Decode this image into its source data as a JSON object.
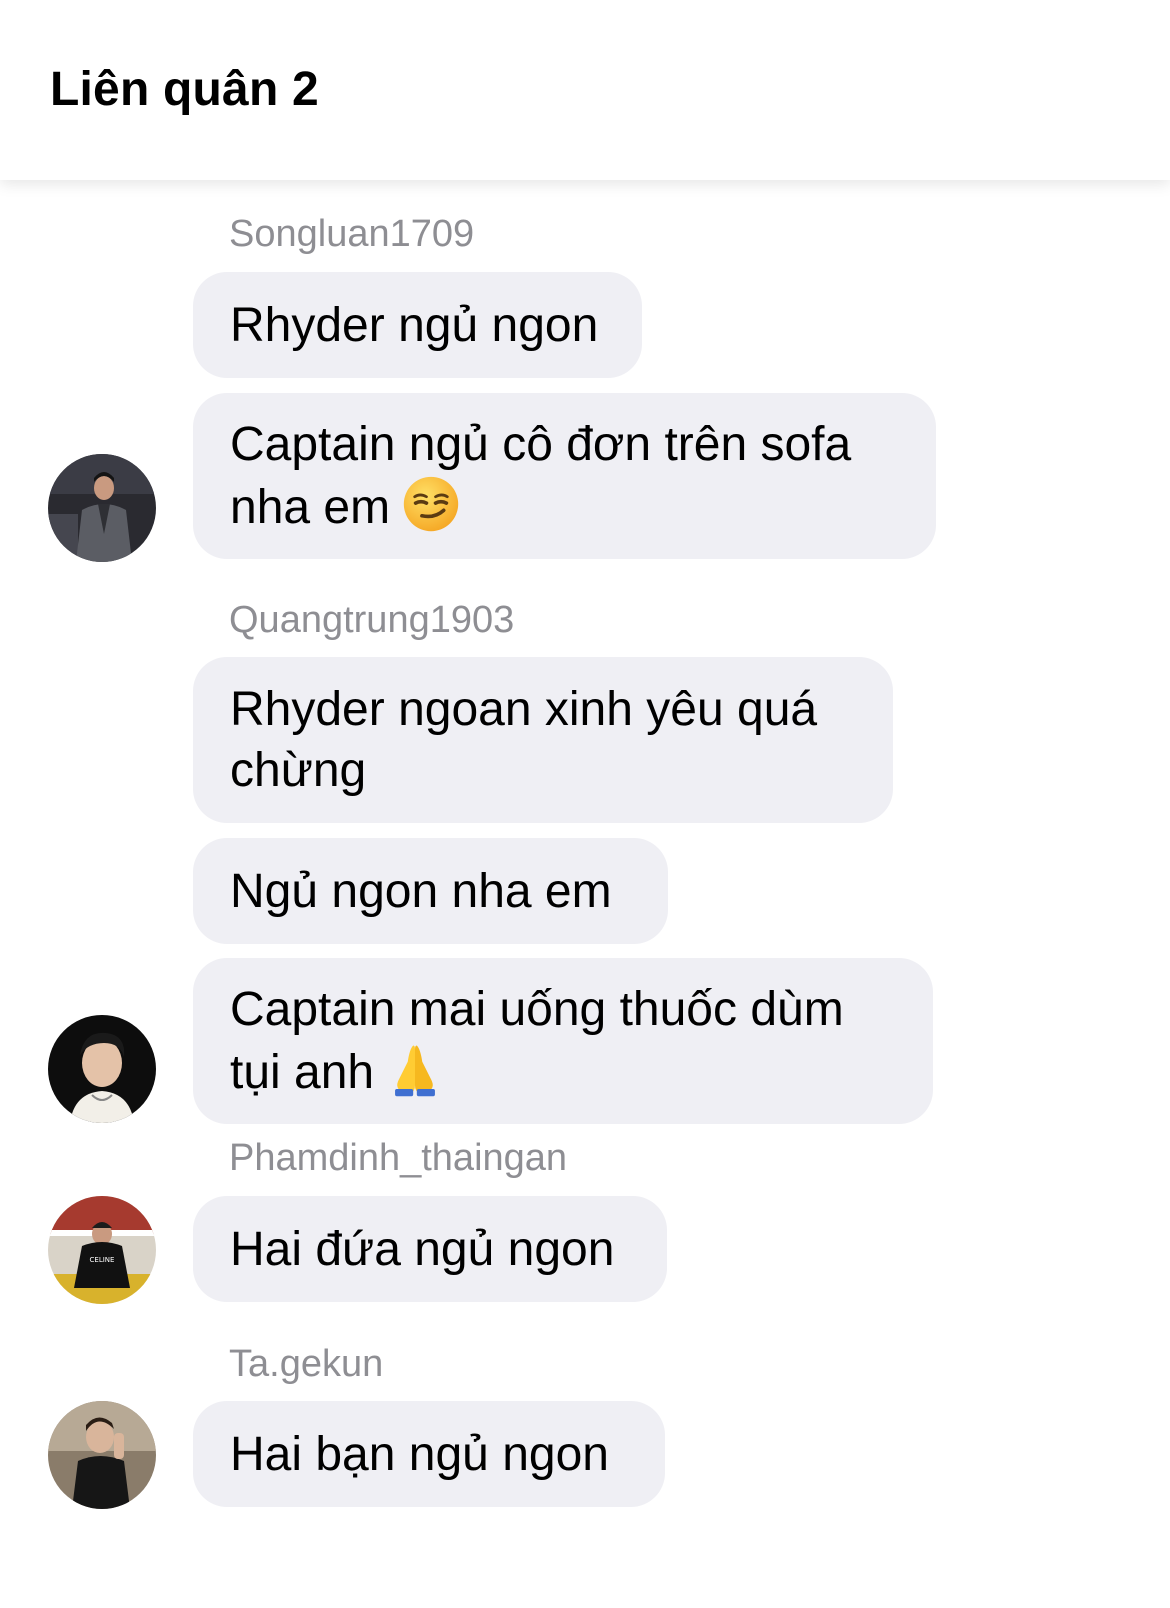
{
  "header": {
    "title": "Liên quân 2"
  },
  "messages": [
    {
      "sender": "Songluan1709",
      "bubbles": [
        "Rhyder ngủ ngon",
        "Captain ngủ cô đơn trên sofa nha em"
      ],
      "emoji": "smirking-face-icon"
    },
    {
      "sender": "Quangtrung1903",
      "bubbles": [
        "Rhyder ngoan xinh yêu quá chừng",
        "Ngủ ngon nha em",
        "Captain mai uống thuốc dùm tụi anh"
      ],
      "emoji": "folded-hands-icon"
    },
    {
      "sender": "Phamdinh_thaingan",
      "bubbles": [
        "Hai đứa ngủ ngon"
      ]
    },
    {
      "sender": "Ta.gekun",
      "bubbles": [
        "Hai bạn ngủ ngon"
      ]
    }
  ],
  "avatar_shirt_text": "CELINE",
  "colors": {
    "bubble": "#efeff4",
    "sender": "#8e8e93",
    "text": "#000000"
  }
}
